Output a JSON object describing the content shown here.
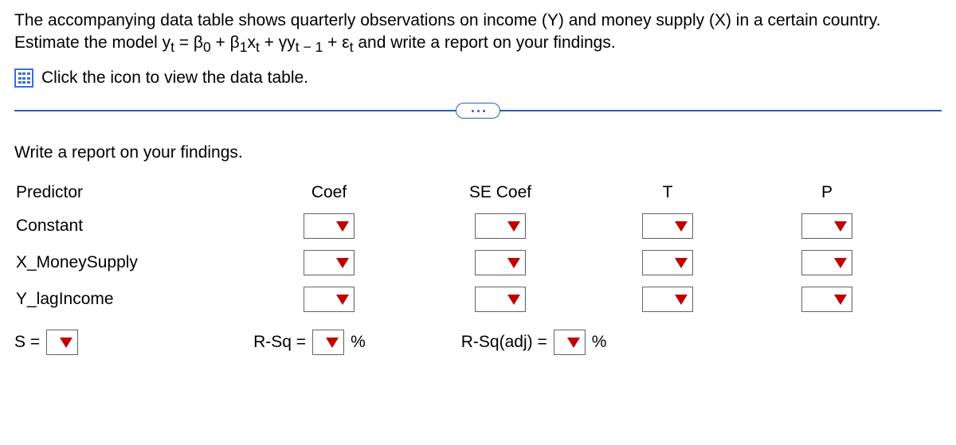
{
  "problem": {
    "line1": "The accompanying data table shows quarterly observations on income (Y) and money supply (X) in a certain country.",
    "line2_pre": "Estimate the model ",
    "line2_post": " and write a report on your findings.",
    "model_plain": "y_t = β0 + β1 x_t + γ y_{t-1} + ε_t"
  },
  "data_link": "Click the icon to view the data table.",
  "section_prompt": "Write a report on your findings.",
  "headers": {
    "predictor": "Predictor",
    "coef": "Coef",
    "secoef": "SE Coef",
    "t": "T",
    "p": "P"
  },
  "rows": {
    "constant": "Constant",
    "money": "X_MoneySupply",
    "lag": "Y_lagIncome"
  },
  "bottom": {
    "s_label": "S =",
    "rsq_label": "R-Sq =",
    "rsqadj_label": "R-Sq(adj) =",
    "percent": "%"
  }
}
